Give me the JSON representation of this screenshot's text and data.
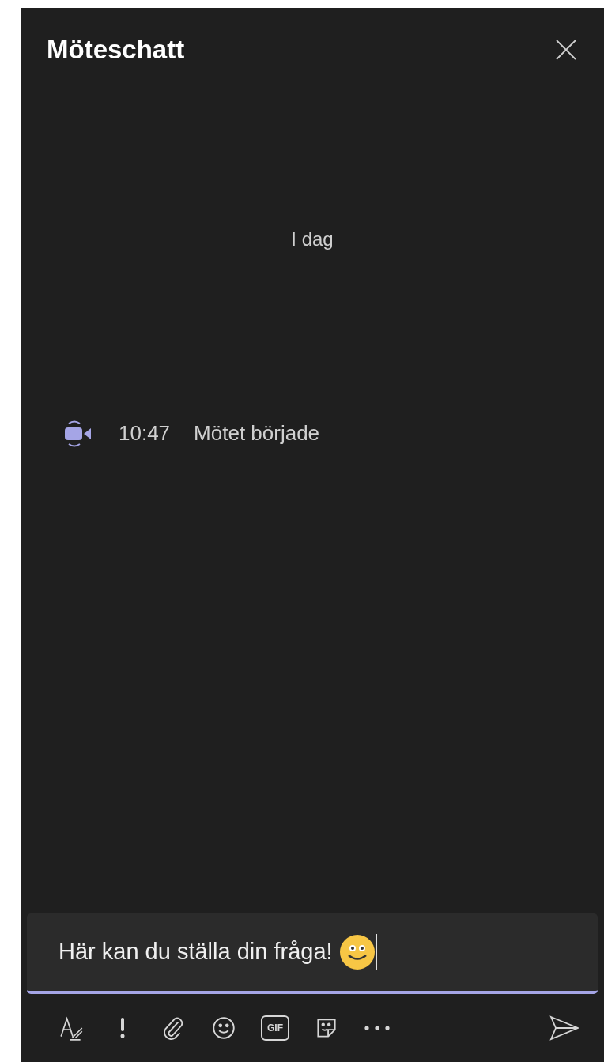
{
  "header": {
    "title": "Möteschatt"
  },
  "date_divider": "I dag",
  "events": [
    {
      "time": "10:47",
      "text": "Mötet började"
    }
  ],
  "composer": {
    "value": "Här kan du ställa din fråga!",
    "focused": true
  },
  "toolbar": [
    {
      "kind": "format"
    },
    {
      "kind": "important"
    },
    {
      "kind": "attach"
    },
    {
      "kind": "emoji"
    },
    {
      "kind": "gif",
      "label": "GIF"
    },
    {
      "kind": "sticker"
    },
    {
      "kind": "more"
    }
  ]
}
